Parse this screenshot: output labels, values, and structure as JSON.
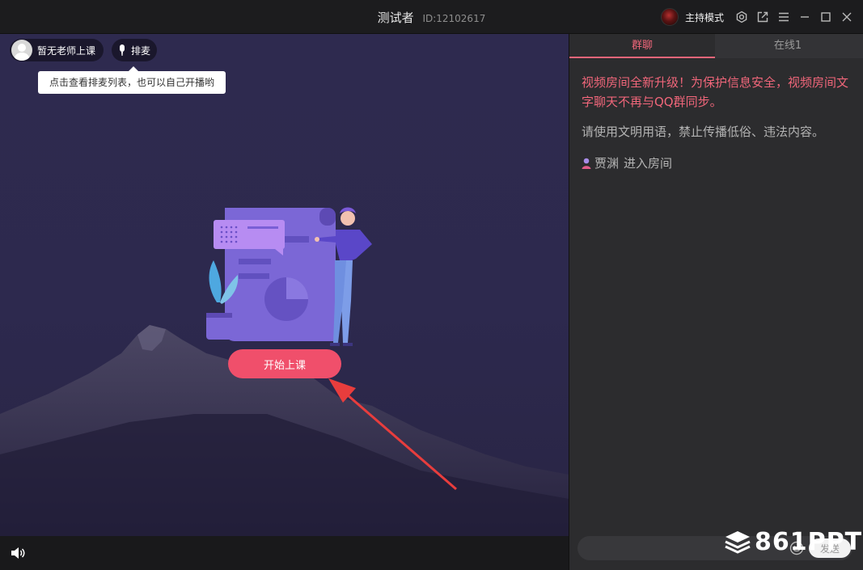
{
  "titlebar": {
    "title": "测试者",
    "user_id": "ID:12102617",
    "mode_label": "主持模式",
    "icons": [
      "settings-icon",
      "popout-icon",
      "menu-icon",
      "minimize-icon",
      "maximize-icon",
      "close-icon"
    ]
  },
  "video": {
    "teacher_pill": "暂无老师上课",
    "queue_pill": "排麦",
    "tooltip": "点击查看排麦列表，也可以自己开播哟",
    "start_button": "开始上课"
  },
  "chat": {
    "tabs": [
      {
        "label": "群聊",
        "active": true
      },
      {
        "label": "在线1",
        "active": false
      }
    ],
    "messages": {
      "notice": "视频房间全新升级！为保护信息安全，视频房间文字聊天不再与QQ群同步。",
      "rule": "请使用文明用语，禁止传播低俗、违法内容。",
      "join_user": "贾渊",
      "join_text": "进入房间"
    },
    "input": {
      "placeholder": "",
      "send_label": "发送"
    }
  },
  "watermark": {
    "text": "861PPT"
  },
  "colors": {
    "accent": "#f04f6b",
    "notice_text": "#f0667a",
    "video_bg": "#2e2a4f",
    "panel_bg": "#2c2c2e"
  }
}
